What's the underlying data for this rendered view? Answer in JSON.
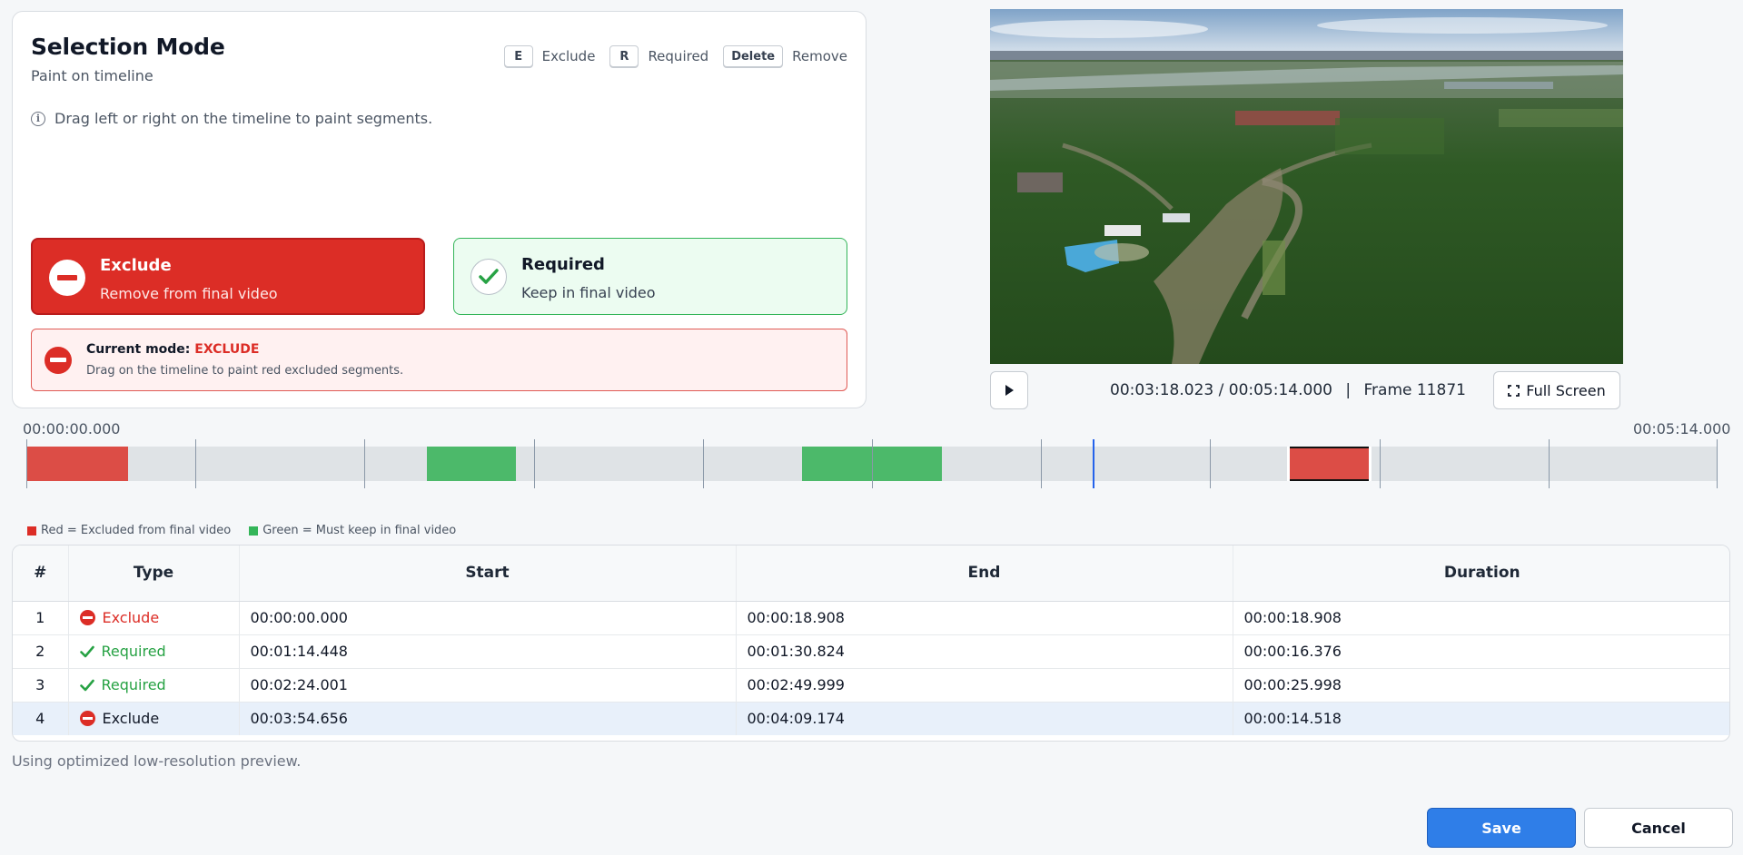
{
  "selection": {
    "title": "Selection Mode",
    "subtitle": "Paint on timeline",
    "hint": "Drag left or right on the timeline to paint segments.",
    "shortcuts": [
      {
        "key": "E",
        "label": "Exclude"
      },
      {
        "key": "R",
        "label": "Required"
      },
      {
        "key": "Delete",
        "label": "Remove"
      }
    ],
    "exclude_button": {
      "title": "Exclude",
      "description": "Remove from final video"
    },
    "required_button": {
      "title": "Required",
      "description": "Keep in final video"
    },
    "current_mode": {
      "prefix": "Current mode:",
      "value": "EXCLUDE",
      "description": "Drag on the timeline to paint red excluded segments."
    }
  },
  "player": {
    "current_time": "00:03:18.023",
    "total_time": "00:05:14.000",
    "separator": "/",
    "pipe": "|",
    "frame_label": "Frame 11871",
    "fullscreen_label": "Full Screen"
  },
  "timeline": {
    "start_label": "00:00:00.000",
    "end_label": "00:05:14.000",
    "duration_seconds": 314.0,
    "playhead_seconds": 198.023,
    "tick_seconds": [
      0,
      31.4,
      62.8,
      94.2,
      125.6,
      157.0,
      188.4,
      219.8,
      251.2,
      282.6,
      314.0
    ],
    "segments": [
      {
        "type": "exclude",
        "start": 0.0,
        "end": 18.908,
        "selected": false
      },
      {
        "type": "required",
        "start": 74.448,
        "end": 90.824,
        "selected": false
      },
      {
        "type": "required",
        "start": 144.001,
        "end": 169.999,
        "selected": false
      },
      {
        "type": "exclude",
        "start": 234.656,
        "end": 249.174,
        "selected": true
      }
    ]
  },
  "legend": {
    "red": "Red = Excluded from final video",
    "green": "Green = Must keep in final video"
  },
  "colors": {
    "exclude": "#dc2d26",
    "exclude_segment": "#dc4d46",
    "required": "#27a244",
    "required_segment": "#4cb96a",
    "playhead": "#2563eb",
    "primary": "#2f7ee8"
  },
  "table": {
    "headers": [
      "#",
      "Type",
      "Start",
      "End",
      "Duration"
    ],
    "rows": [
      {
        "num": "1",
        "type": "Exclude",
        "start": "00:00:00.000",
        "end": "00:00:18.908",
        "duration": "00:00:18.908"
      },
      {
        "num": "2",
        "type": "Required",
        "start": "00:01:14.448",
        "end": "00:01:30.824",
        "duration": "00:00:16.376"
      },
      {
        "num": "3",
        "type": "Required",
        "start": "00:02:24.001",
        "end": "00:02:49.999",
        "duration": "00:00:25.998"
      },
      {
        "num": "4",
        "type": "Exclude",
        "start": "00:03:54.656",
        "end": "00:04:09.174",
        "duration": "00:00:14.518",
        "selected": true
      }
    ]
  },
  "footnote": "Using optimized low-resolution preview.",
  "actions": {
    "save": "Save",
    "cancel": "Cancel"
  }
}
